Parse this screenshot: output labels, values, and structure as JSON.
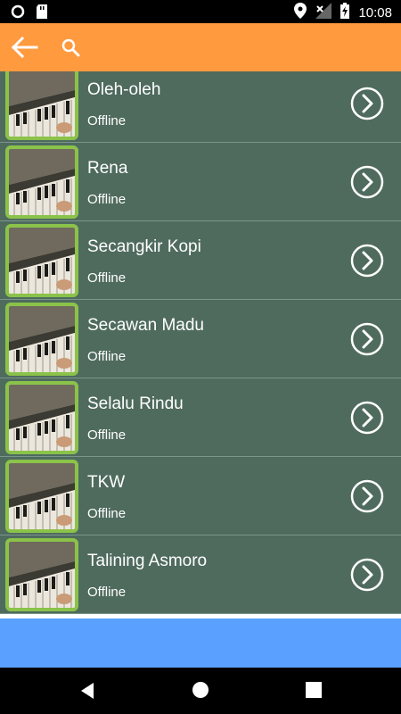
{
  "status_bar": {
    "time": "10:08",
    "icons": [
      "circle-notification-icon",
      "sd-card-icon",
      "location-icon",
      "signal-off-icon",
      "battery-charging-icon"
    ]
  },
  "toolbar": {
    "back_icon": "arrow-left-icon",
    "search_icon": "search-icon",
    "color": "#ff9a3e"
  },
  "songs": [
    {
      "title": "Oleh-oleh",
      "status": "Offline"
    },
    {
      "title": "Rena",
      "status": "Offline"
    },
    {
      "title": "Secangkir Kopi",
      "status": "Offline"
    },
    {
      "title": "Secawan Madu",
      "status": "Offline"
    },
    {
      "title": "Selalu Rindu",
      "status": "Offline"
    },
    {
      "title": "TKW",
      "status": "Offline"
    },
    {
      "title": "Talining Asmoro",
      "status": "Offline"
    }
  ],
  "colors": {
    "list_background": "#4f6b5e",
    "thumb_border": "#8bc34a",
    "banner": "#59a0ff"
  },
  "nav_bar": {
    "icons": [
      "nav-back-icon",
      "nav-home-icon",
      "nav-recents-icon"
    ]
  }
}
